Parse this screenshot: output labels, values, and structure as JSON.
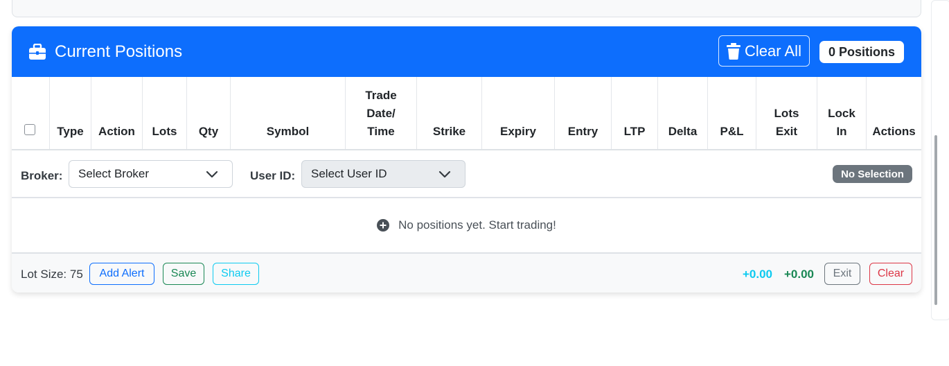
{
  "panel": {
    "title": "Current Positions",
    "clear_all_label": "Clear All",
    "positions_badge": "0 Positions"
  },
  "table": {
    "columns": [
      {
        "key": "select",
        "label": ""
      },
      {
        "key": "type",
        "label": "Type"
      },
      {
        "key": "action",
        "label": "Action"
      },
      {
        "key": "lots",
        "label": "Lots"
      },
      {
        "key": "qty",
        "label": "Qty"
      },
      {
        "key": "symbol",
        "label": "Symbol"
      },
      {
        "key": "trade_datetime",
        "label": "Trade\nDate/\nTime"
      },
      {
        "key": "strike",
        "label": "Strike"
      },
      {
        "key": "expiry",
        "label": "Expiry"
      },
      {
        "key": "entry",
        "label": "Entry"
      },
      {
        "key": "ltp",
        "label": "LTP"
      },
      {
        "key": "delta",
        "label": "Delta"
      },
      {
        "key": "pnl",
        "label": "P&L"
      },
      {
        "key": "lots_exit",
        "label": "Lots\nExit"
      },
      {
        "key": "lock_in",
        "label": "Lock\nIn"
      },
      {
        "key": "actions",
        "label": "Actions"
      }
    ],
    "empty_message": "No positions yet. Start trading!"
  },
  "filters": {
    "broker_label": "Broker:",
    "broker_value": "Select Broker",
    "user_label": "User ID:",
    "user_value": "Select User ID",
    "selection_badge": "No Selection"
  },
  "footer": {
    "lot_size": "Lot Size: 75",
    "add_alert": "Add Alert",
    "save": "Save",
    "share": "Share",
    "pnl_primary": "+0.00",
    "pnl_secondary": "+0.00",
    "exit": "Exit",
    "clear": "Clear"
  },
  "colors": {
    "header_bg": "#0d6efd",
    "pnl_primary": "#0dcaf0",
    "pnl_secondary": "#198754",
    "danger": "#dc3545",
    "secondary": "#6c757d"
  },
  "icons": {
    "title": "briefcase-icon",
    "clear_all": "trash-icon",
    "empty": "plus-circle-icon",
    "select": "chevron-down-icon"
  }
}
